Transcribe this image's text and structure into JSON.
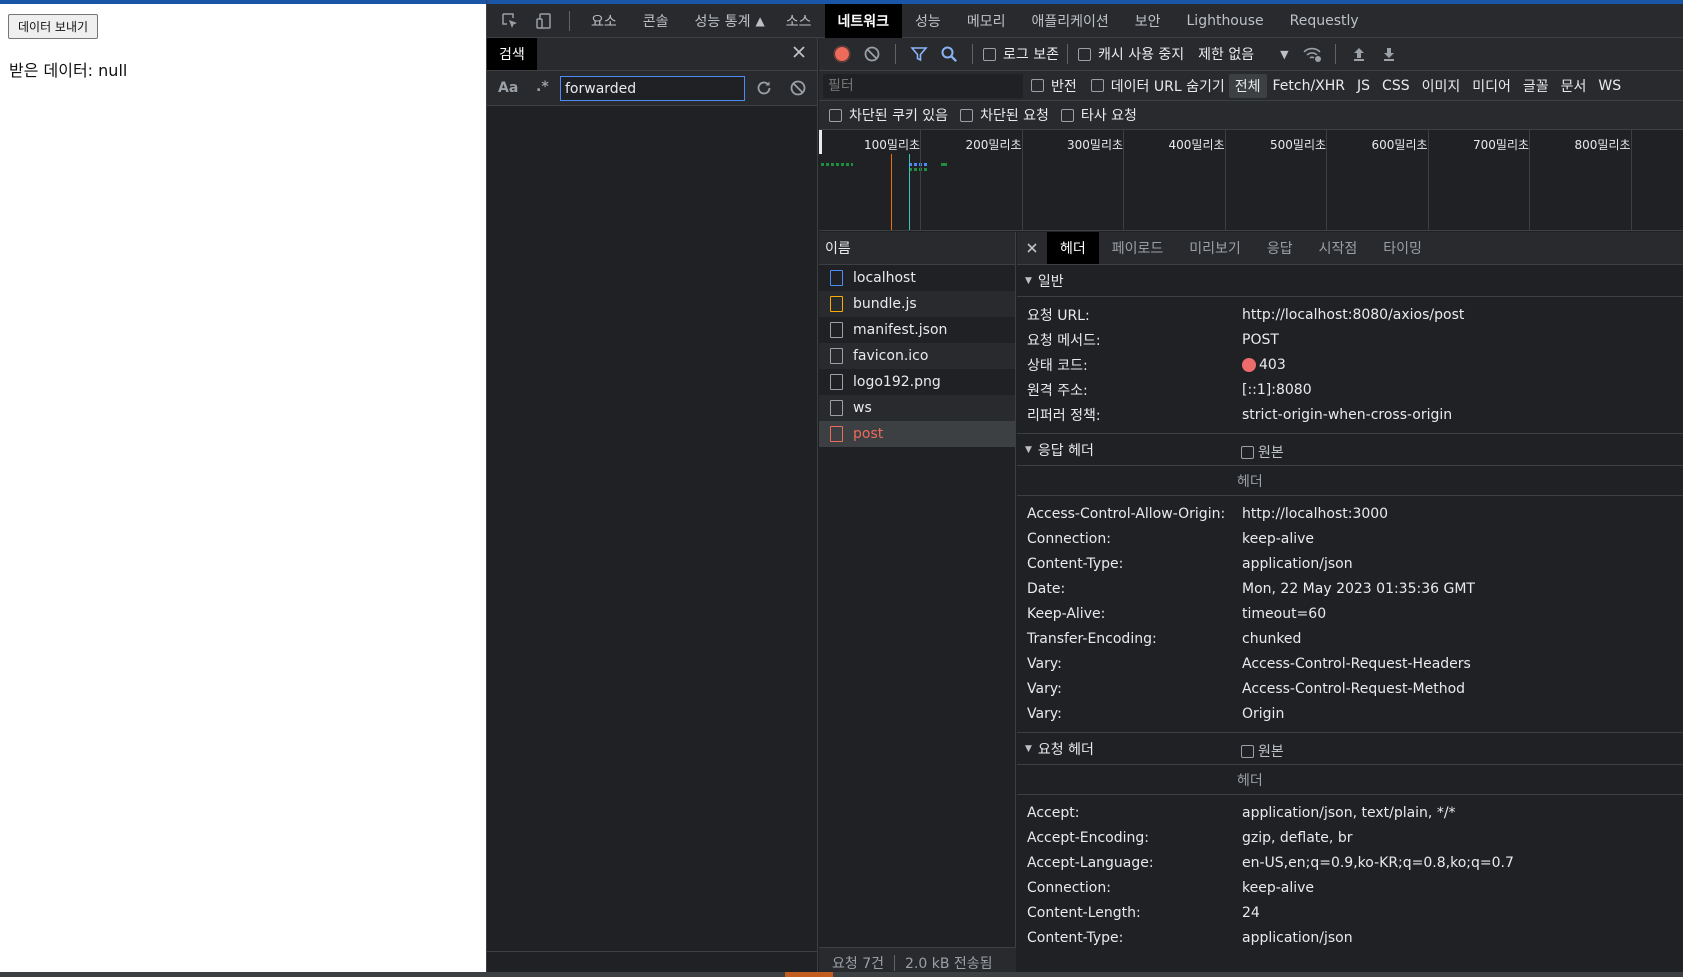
{
  "page": {
    "send_button": "데이터 보내기",
    "received_text": "받은 데이터: null"
  },
  "devtools": {
    "top_tabs": [
      "요소",
      "콘솔",
      "성능 통계",
      "소스",
      "네트워크",
      "성능",
      "메모리",
      "애플리케이션",
      "보안",
      "Lighthouse",
      "Requestly"
    ],
    "active_top_tab": "네트워크",
    "search": {
      "title": "검색",
      "case_label": "Aa",
      "regex_label": ".*",
      "query": "forwarded"
    },
    "toolbar": {
      "preserve_log": "로그 보존",
      "disable_cache": "캐시 사용 중지",
      "throttle": "제한 없음"
    },
    "filter": {
      "placeholder": "필터",
      "invert": "반전",
      "hide_data_urls": "데이터 URL 숨기기",
      "types": [
        "전체",
        "Fetch/XHR",
        "JS",
        "CSS",
        "이미지",
        "미디어",
        "글꼴",
        "문서",
        "WS"
      ],
      "active_type": "전체",
      "blocked_cookies": "차단된 쿠키 있음",
      "blocked_requests": "차단된 요청",
      "third_party": "타사 요청"
    },
    "overview_ticks": [
      "100밀리초",
      "200밀리초",
      "300밀리초",
      "400밀리초",
      "500밀리초",
      "600밀리초",
      "700밀리초",
      "800밀리초"
    ],
    "names": {
      "header": "이름",
      "rows": [
        {
          "name": "localhost",
          "type": "doc"
        },
        {
          "name": "bundle.js",
          "type": "js"
        },
        {
          "name": "manifest.json",
          "type": "other"
        },
        {
          "name": "favicon.ico",
          "type": "other"
        },
        {
          "name": "logo192.png",
          "type": "other"
        },
        {
          "name": "ws",
          "type": "other"
        },
        {
          "name": "post",
          "type": "err"
        }
      ],
      "status_requests": "요청 7건",
      "status_transferred": "2.0 kB 전송됨"
    },
    "detail_tabs": [
      "헤더",
      "페이로드",
      "미리보기",
      "응답",
      "시작점",
      "타이밍"
    ],
    "active_detail_tab": "헤더",
    "general": {
      "title": "일반",
      "rows": [
        {
          "k": "요청 URL:",
          "v": "http://localhost:8080/axios/post"
        },
        {
          "k": "요청 메서드:",
          "v": "POST"
        },
        {
          "k": "상태 코드:",
          "v": "403",
          "status_color": "#ee6b6b"
        },
        {
          "k": "원격 주소:",
          "v": "[::1]:8080"
        },
        {
          "k": "리퍼러 정책:",
          "v": "strict-origin-when-cross-origin"
        }
      ]
    },
    "response_headers": {
      "title": "응답 헤더",
      "raw_label": "원본",
      "sub_label": "헤더",
      "rows": [
        {
          "k": "Access-Control-Allow-Origin:",
          "v": "http://localhost:3000"
        },
        {
          "k": "Connection:",
          "v": "keep-alive"
        },
        {
          "k": "Content-Type:",
          "v": "application/json"
        },
        {
          "k": "Date:",
          "v": "Mon, 22 May 2023 01:35:36 GMT"
        },
        {
          "k": "Keep-Alive:",
          "v": "timeout=60"
        },
        {
          "k": "Transfer-Encoding:",
          "v": "chunked"
        },
        {
          "k": "Vary:",
          "v": "Access-Control-Request-Headers"
        },
        {
          "k": "Vary:",
          "v": "Access-Control-Request-Method"
        },
        {
          "k": "Vary:",
          "v": "Origin"
        }
      ]
    },
    "request_headers": {
      "title": "요청 헤더",
      "raw_label": "원본",
      "sub_label": "헤더",
      "rows": [
        {
          "k": "Accept:",
          "v": "application/json, text/plain, */*"
        },
        {
          "k": "Accept-Encoding:",
          "v": "gzip, deflate, br"
        },
        {
          "k": "Accept-Language:",
          "v": "en-US,en;q=0.9,ko-KR;q=0.8,ko;q=0.7"
        },
        {
          "k": "Connection:",
          "v": "keep-alive"
        },
        {
          "k": "Content-Length:",
          "v": "24"
        },
        {
          "k": "Content-Type:",
          "v": "application/json"
        }
      ]
    },
    "colors": {
      "accent": "#1a56a8",
      "record": "#ee6b5b",
      "link": "#4c8bf5"
    }
  }
}
